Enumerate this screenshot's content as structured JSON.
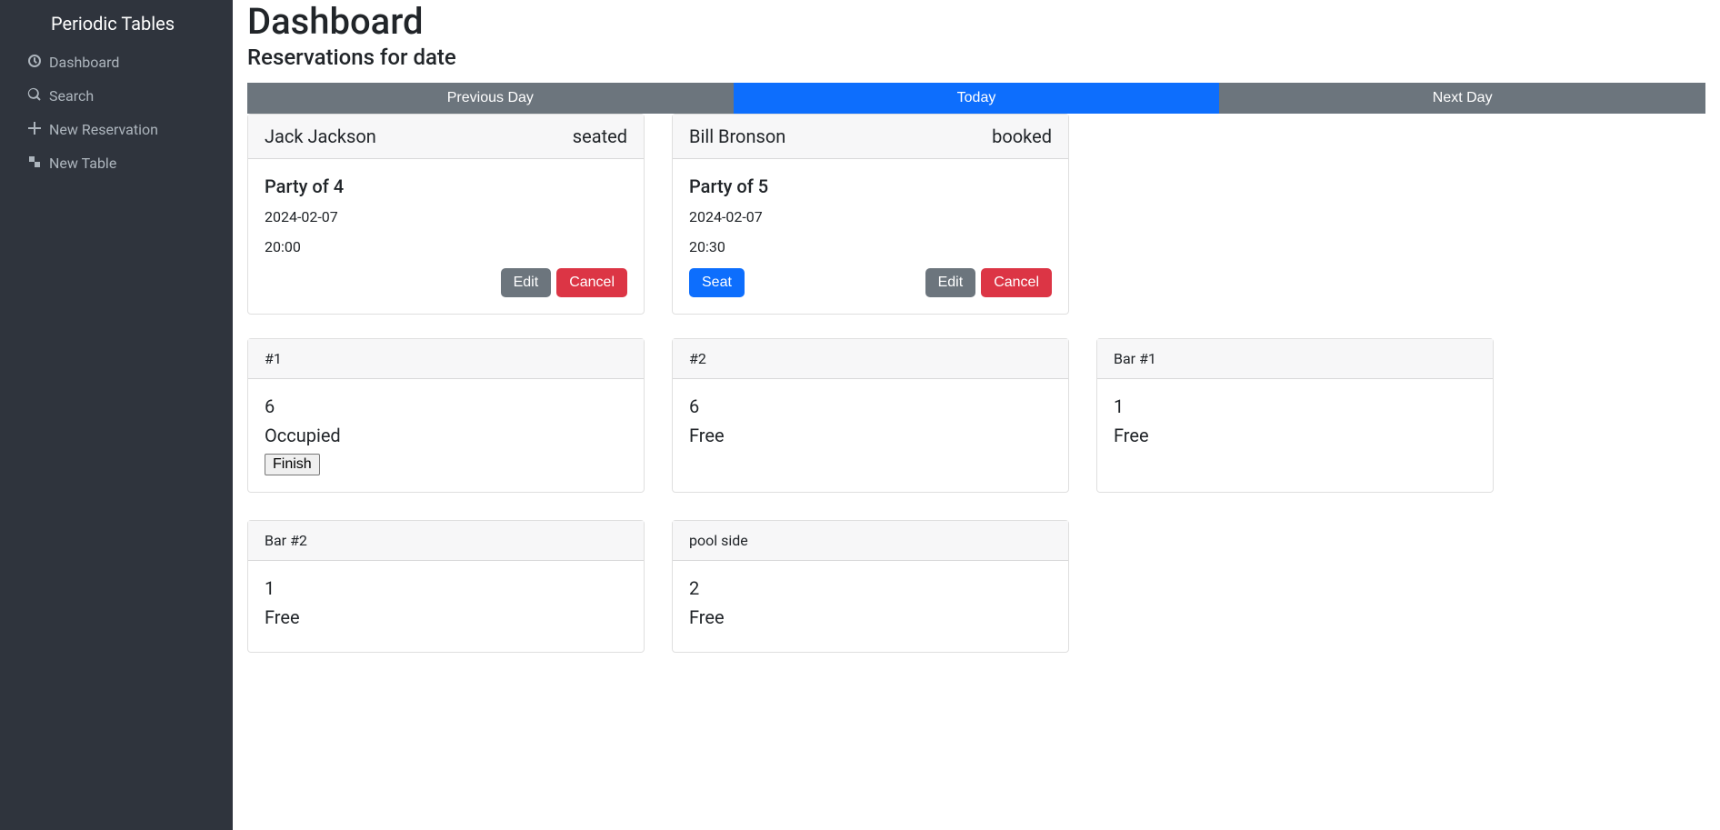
{
  "sidebar": {
    "brand": "Periodic Tables",
    "items": [
      {
        "label": "Dashboard"
      },
      {
        "label": "Search"
      },
      {
        "label": "New Reservation"
      },
      {
        "label": "New Table"
      }
    ]
  },
  "header": {
    "title": "Dashboard",
    "subtitle": "Reservations for date"
  },
  "dayNav": {
    "previous": "Previous Day",
    "today": "Today",
    "next": "Next Day"
  },
  "buttons": {
    "seat": "Seat",
    "edit": "Edit",
    "cancel": "Cancel",
    "finish": "Finish"
  },
  "reservations": [
    {
      "name": "Jack Jackson",
      "status": "seated",
      "party": "Party of 4",
      "date": "2024-02-07",
      "time": "20:00",
      "showSeat": false
    },
    {
      "name": "Bill Bronson",
      "status": "booked",
      "party": "Party of 5",
      "date": "2024-02-07",
      "time": "20:30",
      "showSeat": true
    }
  ],
  "tables": [
    {
      "name": "#1",
      "capacity": "6",
      "status": "Occupied",
      "showFinish": true
    },
    {
      "name": "#2",
      "capacity": "6",
      "status": "Free",
      "showFinish": false
    },
    {
      "name": "Bar #1",
      "capacity": "1",
      "status": "Free",
      "showFinish": false
    },
    {
      "name": "Bar #2",
      "capacity": "1",
      "status": "Free",
      "showFinish": false
    },
    {
      "name": "pool side",
      "capacity": "2",
      "status": "Free",
      "showFinish": false
    }
  ]
}
